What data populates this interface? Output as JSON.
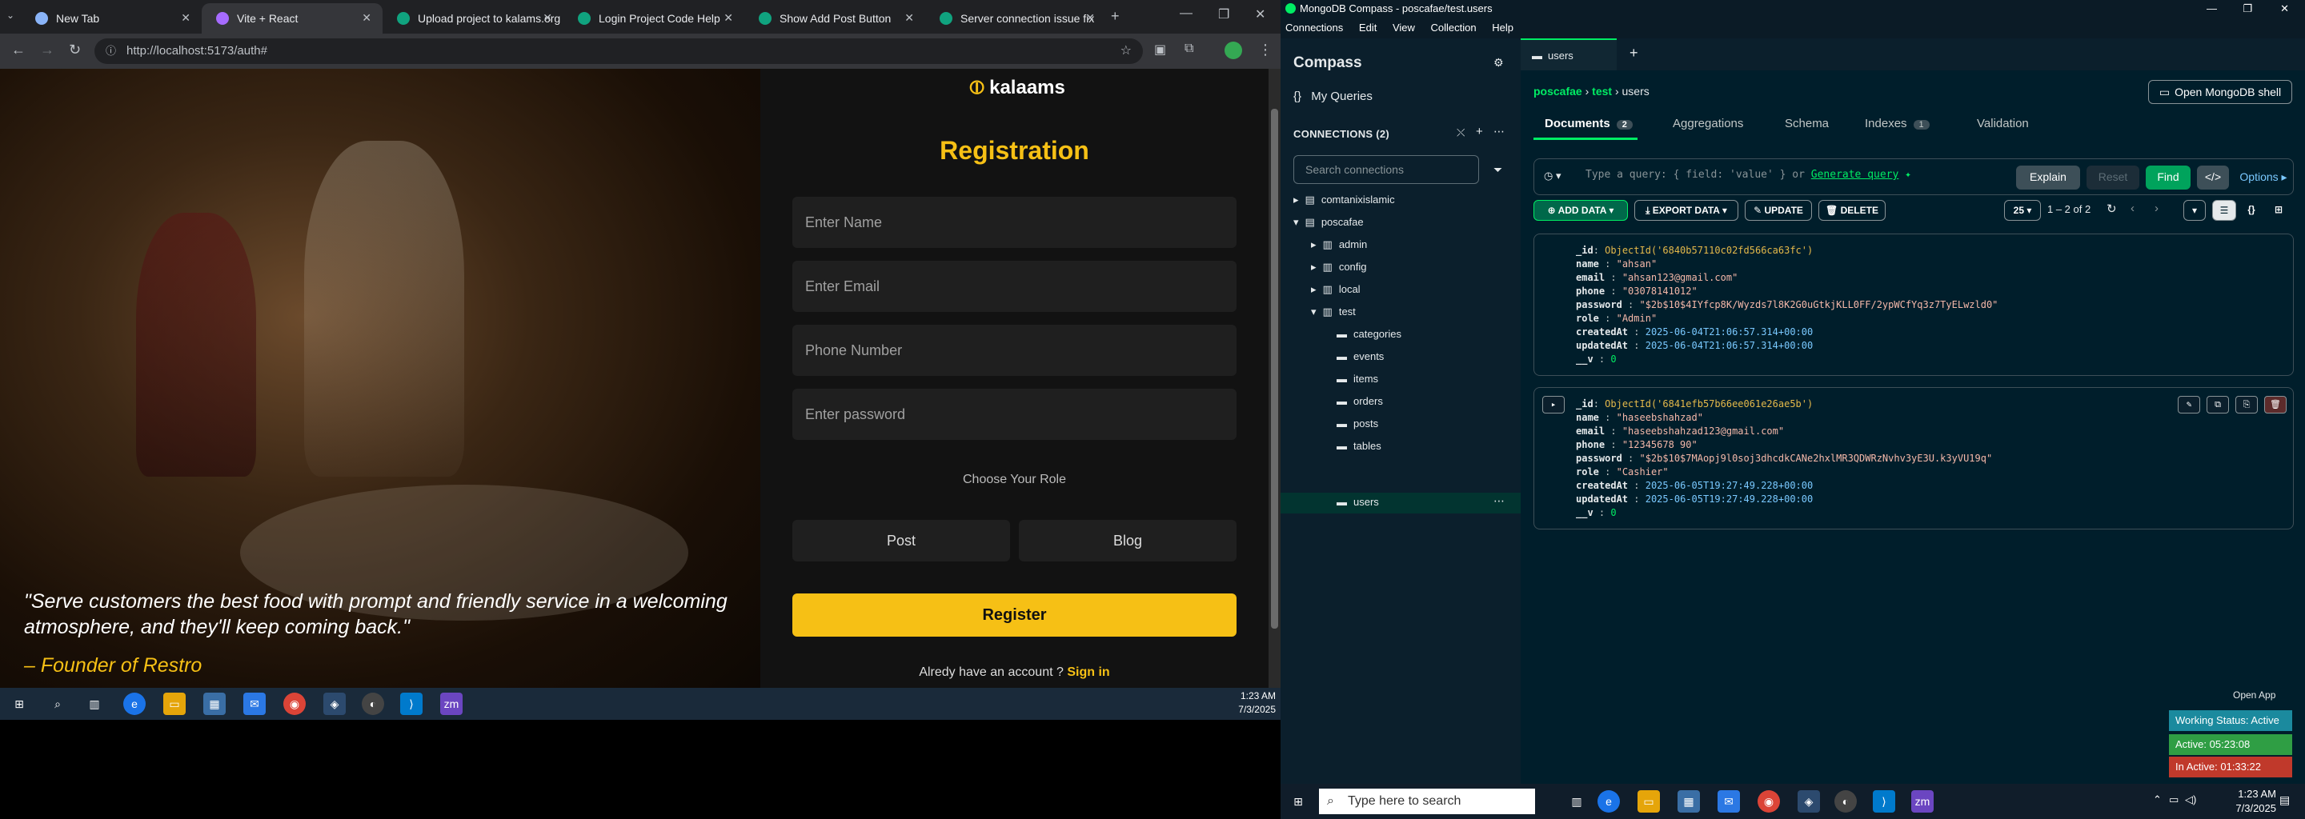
{
  "browser": {
    "tabs": [
      {
        "label": "New Tab",
        "active": false
      },
      {
        "label": "Vite + React",
        "active": true
      },
      {
        "label": "Upload project to kalams.org",
        "active": false
      },
      {
        "label": "Login Project Code Help",
        "active": false
      },
      {
        "label": "Show Add Post Button",
        "active": false
      },
      {
        "label": "Server connection issue fix",
        "active": false
      }
    ],
    "url": "http://localhost:5173/auth#"
  },
  "app": {
    "logo": "kalaams",
    "title": "Registration",
    "fields": {
      "name_placeholder": "Enter Name",
      "email_placeholder": "Enter Email",
      "phone_placeholder": "Phone Number",
      "password_placeholder": "Enter password"
    },
    "role_label": "Choose Your Role",
    "roles": [
      "Post",
      "Blog"
    ],
    "register_label": "Register",
    "signin_text": "Alredy have an account ?",
    "signin_link": "Sign in",
    "quote": "\"Serve customers the best food with prompt and friendly service in a welcoming atmosphere, and they'll keep coming back.\"",
    "founder": "– Founder of Restro"
  },
  "taskbar_left": {
    "time": "1:23 AM",
    "date": "7/3/2025"
  },
  "compass": {
    "window_title": "MongoDB Compass - poscafae/test.users",
    "menu": [
      "Connections",
      "Edit",
      "View",
      "Collection",
      "Help"
    ],
    "sidebar": {
      "title": "Compass",
      "my_queries": "My Queries",
      "connections_label": "CONNECTIONS (2)",
      "search_placeholder": "Search connections",
      "tree": [
        {
          "label": "comtanixislamic",
          "level": 0
        },
        {
          "label": "poscafae",
          "level": 0
        },
        {
          "label": "admin",
          "level": 1
        },
        {
          "label": "config",
          "level": 1
        },
        {
          "label": "local",
          "level": 1
        },
        {
          "label": "test",
          "level": 1
        },
        {
          "label": "categories",
          "level": 2
        },
        {
          "label": "events",
          "level": 2
        },
        {
          "label": "items",
          "level": 2
        },
        {
          "label": "orders",
          "level": 2
        },
        {
          "label": "posts",
          "level": 2
        },
        {
          "label": "tables",
          "level": 2
        },
        {
          "label": "users",
          "level": 2
        }
      ]
    },
    "tab": "users",
    "breadcrumb": {
      "db1": "poscafae",
      "db2": "test",
      "coll": "users"
    },
    "shell_button": "Open MongoDB shell",
    "subtabs": {
      "documents": "Documents",
      "documents_count": "2",
      "aggregations": "Aggregations",
      "schema": "Schema",
      "indexes": "Indexes",
      "indexes_count": "1",
      "validation": "Validation"
    },
    "query": {
      "placeholder": "Type a query: { field: 'value' } or",
      "generate": "Generate query",
      "explain": "Explain",
      "reset": "Reset",
      "find": "Find",
      "options": "Options"
    },
    "actions": {
      "add_data": "ADD DATA",
      "export_data": "EXPORT DATA",
      "update": "UPDATE",
      "delete": "DELETE",
      "page_size": "25",
      "range": "1 – 2 of 2"
    },
    "documents": [
      {
        "_id": "ObjectId('6840b57110c02fd566ca63fc')",
        "name": "\"ahsan\"",
        "email": "\"ahsan123@gmail.com\"",
        "phone": "\"03078141012\"",
        "password": "\"$2b$10$4IYfcp8K/Wyzds7l8K2G0uGtkjKLL0FF/2ypWCfYq3z7TyELwzld0\"",
        "role": "\"Admin\"",
        "createdAt": "2025-06-04T21:06:57.314+00:00",
        "updatedAt": "2025-06-04T21:06:57.314+00:00",
        "__v": "0"
      },
      {
        "_id": "ObjectId('6841efb57b66ee061e26ae5b')",
        "name": "\"haseebshahzad\"",
        "email": "\"haseebshahzad123@gmail.com\"",
        "phone": "\"12345678 90\"",
        "password": "\"$2b$10$7MAopj9l0soj3dhcdkCANe2hxlMR3QDWRzNvhv3yE3U.k3yVU19q\"",
        "role": "\"Cashier\"",
        "createdAt": "2025-06-05T19:27:49.228+00:00",
        "updatedAt": "2025-06-05T19:27:49.228+00:00",
        "__v": "0"
      }
    ]
  },
  "tracker": {
    "open_app": "Open App",
    "working_status": "Working Status: Active",
    "active": "Active: 05:23:08",
    "inactive": "In Active: 01:33:22"
  },
  "taskbar_right": {
    "search_placeholder": "Type here to search",
    "time": "1:23 AM",
    "date": "7/3/2025"
  },
  "colors": {
    "accent": "#f6c015",
    "mongo_green": "#00ed64",
    "compass_bg": "#001e2b"
  }
}
